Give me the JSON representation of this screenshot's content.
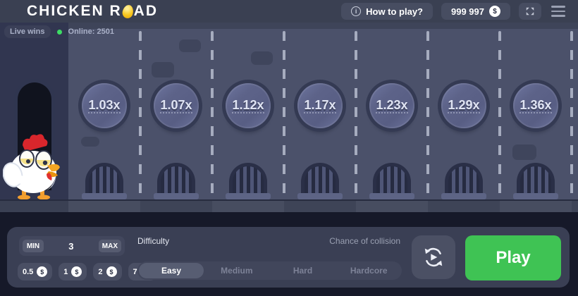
{
  "topbar": {
    "logo_part1": "CHICKEN R",
    "logo_part2": "AD",
    "how_to_play_label": "How to play?",
    "balance": "999 997"
  },
  "icons": {
    "info": "i",
    "dollar": "$",
    "egg": "egg-icon",
    "fullscreen": "fullscreen-expand-icon",
    "menu": "hamburger-menu-icon",
    "autoplay": "circular-arrows-play-icon"
  },
  "status": {
    "live_wins": "Live wins",
    "online": "Online: 2501"
  },
  "road": {
    "multipliers": [
      "1.03x",
      "1.07x",
      "1.12x",
      "1.17x",
      "1.23x",
      "1.29x",
      "1.36x"
    ]
  },
  "controls": {
    "bet": {
      "min_label": "MIN",
      "value": "3",
      "max_label": "MAX"
    },
    "chips": [
      "0.5",
      "1",
      "2",
      "7"
    ],
    "difficulty": {
      "label": "Difficulty",
      "selected": "Easy",
      "options": [
        "Easy",
        "Medium",
        "Hard",
        "Hardcore"
      ]
    },
    "collision_label": "Chance of collision",
    "play_label": "Play"
  },
  "colors": {
    "play_green": "#3fc354",
    "online_green": "#3ddc64",
    "egg_yellow": "#f8c71f",
    "road": "#4b516a",
    "panel": "#3a3f54",
    "topbar": "#3a4052"
  }
}
